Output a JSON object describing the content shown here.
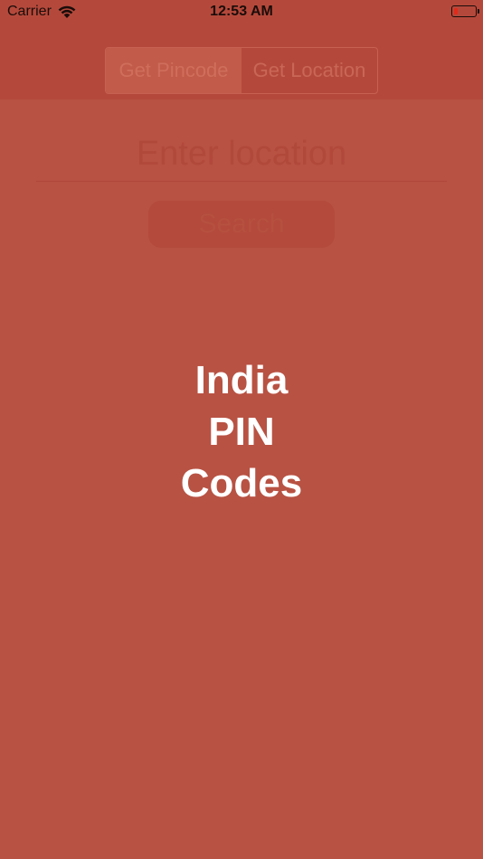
{
  "status_bar": {
    "carrier": "Carrier",
    "time": "12:53 AM",
    "wifi_icon": "wifi-icon",
    "battery_icon": "battery-icon"
  },
  "segmented_control": {
    "items": [
      "Get Pincode",
      "Get Location"
    ],
    "selected": "Get Pincode"
  },
  "search": {
    "placeholder": "Enter location",
    "button_label": "Search"
  },
  "splash": {
    "title_lines": [
      "India",
      "PIN",
      "Codes"
    ]
  },
  "colors": {
    "background": "#b85243",
    "accent": "#c25b49",
    "title_text": "#ffffff"
  }
}
